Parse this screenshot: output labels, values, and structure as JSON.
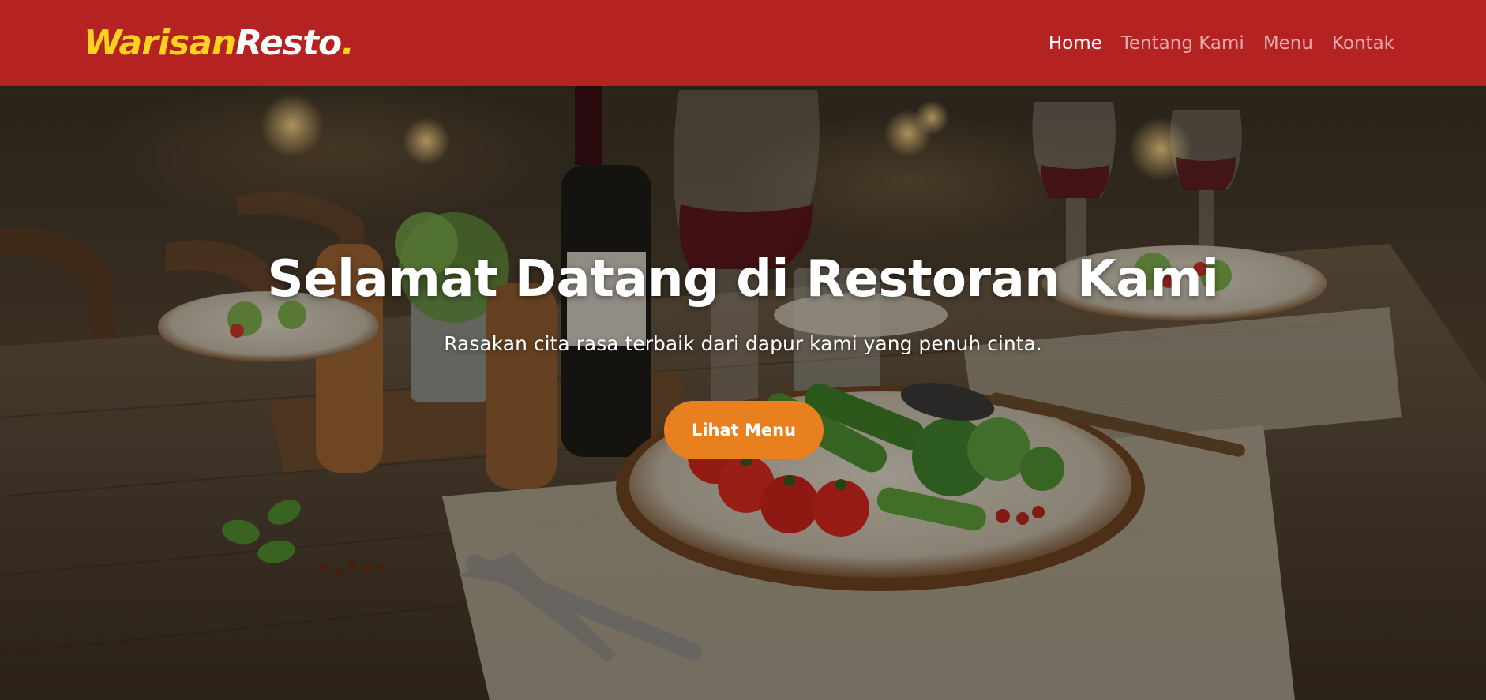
{
  "brand": {
    "part1": "Warisan",
    "part2": "Resto",
    "dot": "."
  },
  "nav": {
    "items": [
      {
        "label": "Home",
        "active": true
      },
      {
        "label": "Tentang Kami",
        "active": false
      },
      {
        "label": "Menu",
        "active": false
      },
      {
        "label": "Kontak",
        "active": false
      }
    ]
  },
  "hero": {
    "title": "Selamat Datang di Restoran Kami",
    "subtitle": "Rasakan cita rasa terbaik dari dapur kami yang penuh cinta.",
    "cta_label": "Lihat Menu"
  },
  "colors": {
    "navbar": "#b52222",
    "brand_accent": "#ffd21f",
    "cta": "#e8801f",
    "text": "#ffffff"
  }
}
